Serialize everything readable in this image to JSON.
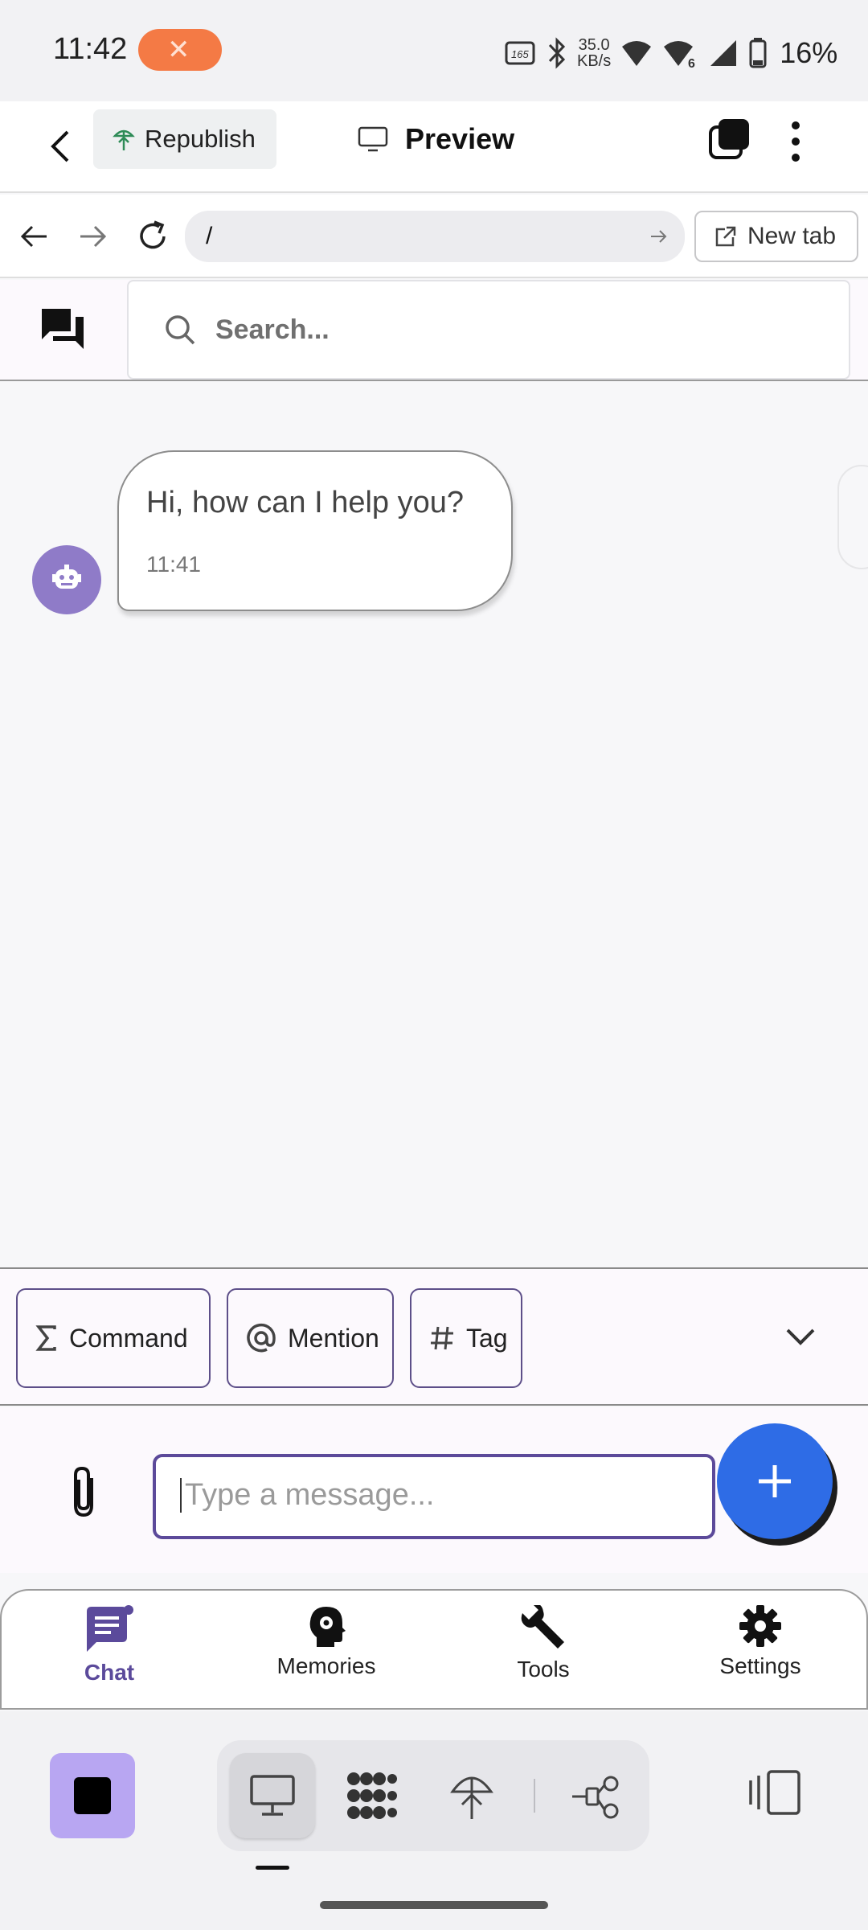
{
  "status_bar": {
    "time": "11:42",
    "net_speed_value": "35.0",
    "net_speed_unit": "KB/s",
    "battery": "16%"
  },
  "top_bar": {
    "republish_label": "Republish",
    "preview_label": "Preview"
  },
  "browser_bar": {
    "url": "/",
    "new_tab_label": "New tab"
  },
  "chat_header": {
    "search_placeholder": "Search..."
  },
  "messages": [
    {
      "sender": "bot",
      "text": "Hi, how can I help you?",
      "time": "11:41"
    }
  ],
  "chips": {
    "command": "Command",
    "mention": "Mention",
    "tag": "Tag"
  },
  "composer": {
    "placeholder": "Type a message..."
  },
  "bottom_nav": {
    "items": [
      {
        "label": "Chat",
        "icon": "chat-icon",
        "active": true
      },
      {
        "label": "Memories",
        "icon": "brain-gear-icon",
        "active": false
      },
      {
        "label": "Tools",
        "icon": "wrench-icon",
        "active": false
      },
      {
        "label": "Settings",
        "icon": "gear-icon",
        "active": false
      }
    ]
  },
  "colors": {
    "accent_purple": "#5b4a9b",
    "fab_blue": "#2e6ce6",
    "recording_orange": "#f47a45",
    "avatar_purple": "#8f7bc8"
  }
}
